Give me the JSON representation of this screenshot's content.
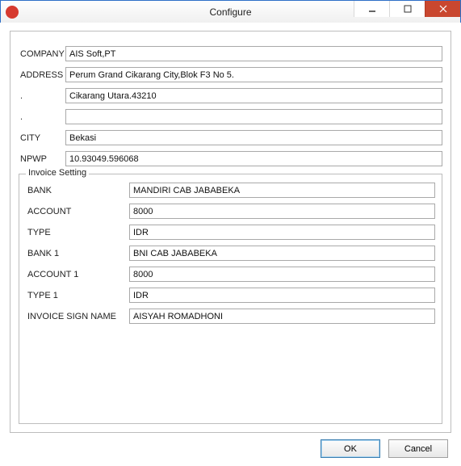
{
  "window": {
    "title": "Configure",
    "app_icon_glyph": "◐"
  },
  "form": {
    "company": {
      "label": "COMPANY",
      "value": "AIS Soft,PT"
    },
    "address": {
      "label": "ADDRESS",
      "value": "Perum Grand Cikarang City,Blok F3 No 5."
    },
    "addr2": {
      "label": ".",
      "value": "Cikarang Utara.43210"
    },
    "addr3": {
      "label": ".",
      "value": ""
    },
    "city": {
      "label": "CITY",
      "value": "Bekasi"
    },
    "npwp": {
      "label": "NPWP",
      "value": "10.93049.596068"
    }
  },
  "invoice": {
    "legend": "Invoice Setting",
    "bank": {
      "label": "BANK",
      "value": "MANDIRI CAB JABABEKA"
    },
    "account": {
      "label": "ACCOUNT",
      "value": "8000"
    },
    "type": {
      "label": "TYPE",
      "value": "IDR"
    },
    "bank1": {
      "label": "BANK 1",
      "value": "BNI CAB JABABEKA"
    },
    "account1": {
      "label": "ACCOUNT 1",
      "value": "8000"
    },
    "type1": {
      "label": "TYPE 1",
      "value": "IDR"
    },
    "sign": {
      "label": "INVOICE SIGN NAME",
      "value": "AISYAH ROMADHONI"
    }
  },
  "buttons": {
    "ok": "OK",
    "cancel": "Cancel"
  }
}
